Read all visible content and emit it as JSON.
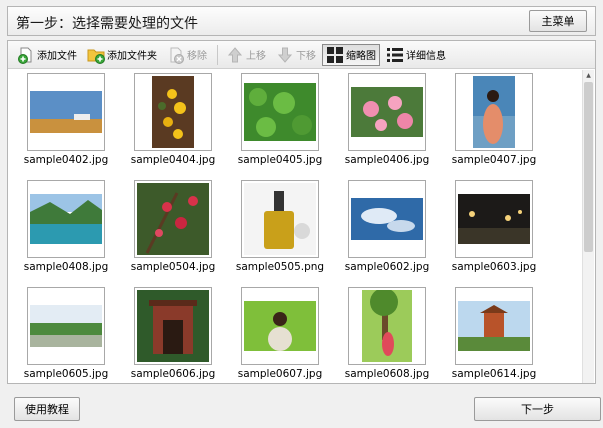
{
  "header": {
    "title": "第一步：选择需要处理的文件",
    "main_menu_label": "主菜单"
  },
  "toolbar": {
    "add_file": "添加文件",
    "add_folder": "添加文件夹",
    "remove": "移除",
    "move_up": "上移",
    "move_down": "下移",
    "thumbnail": "缩略图",
    "details": "详细信息"
  },
  "files": [
    {
      "name": "sample0402.jpg",
      "img": "a"
    },
    {
      "name": "sample0404.jpg",
      "img": "b"
    },
    {
      "name": "sample0405.jpg",
      "img": "c"
    },
    {
      "name": "sample0406.jpg",
      "img": "d"
    },
    {
      "name": "sample0407.jpg",
      "img": "e"
    },
    {
      "name": "sample0408.jpg",
      "img": "f"
    },
    {
      "name": "sample0504.jpg",
      "img": "g"
    },
    {
      "name": "sample0505.png",
      "img": "h"
    },
    {
      "name": "sample0602.jpg",
      "img": "i"
    },
    {
      "name": "sample0603.jpg",
      "img": "j"
    },
    {
      "name": "sample0605.jpg",
      "img": "k"
    },
    {
      "name": "sample0606.jpg",
      "img": "l"
    },
    {
      "name": "sample0607.jpg",
      "img": "m"
    },
    {
      "name": "sample0608.jpg",
      "img": "n"
    },
    {
      "name": "sample0614.jpg",
      "img": "o"
    }
  ],
  "footer": {
    "tutorial_label": "使用教程",
    "next_label": "下一步"
  }
}
